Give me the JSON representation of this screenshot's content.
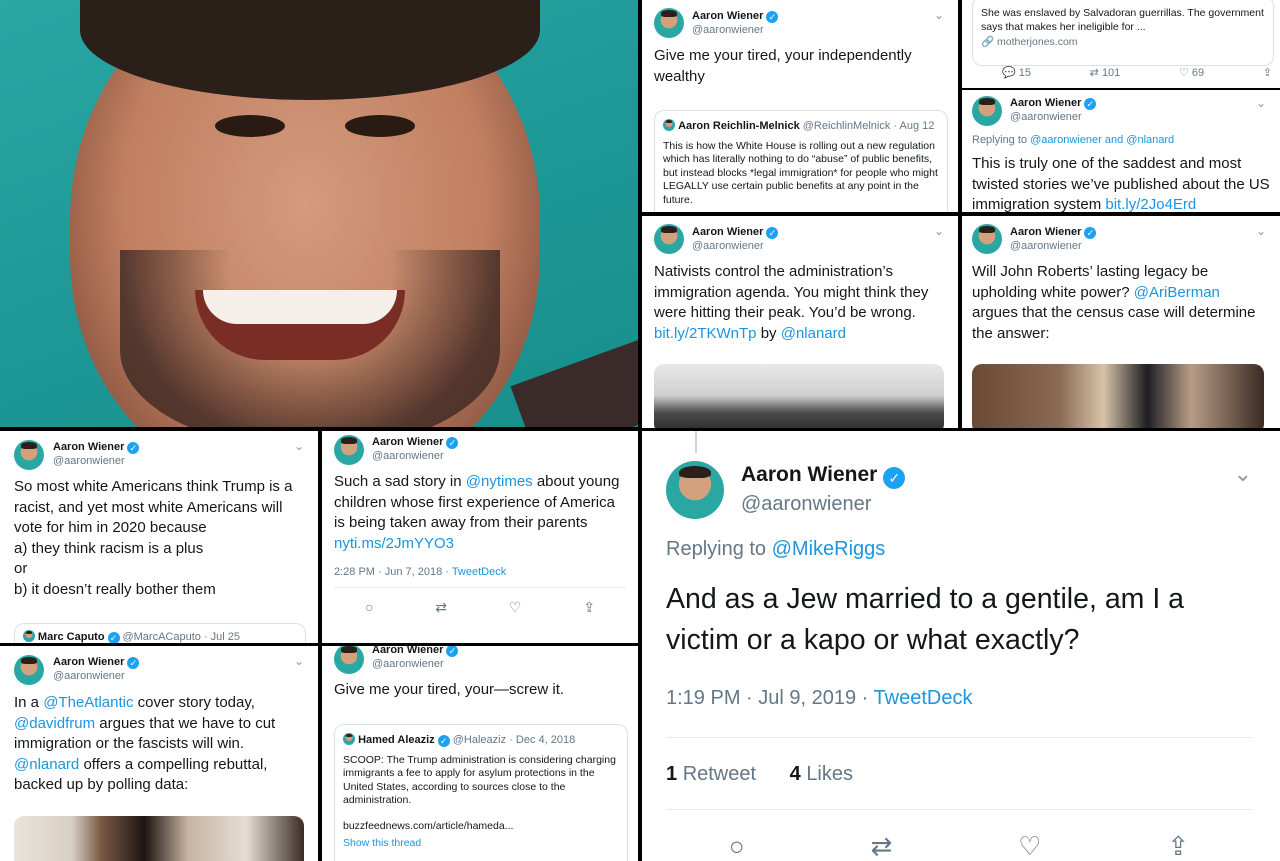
{
  "tweets": {
    "t1": {
      "name": "Aaron Wiener",
      "handle": "@aaronwiener",
      "text": "Give me your tired, your independently wealthy",
      "quote": {
        "name": "Aaron Reichlin-Melnick",
        "handle": "@ReichlinMelnick",
        "date": "· Aug 12",
        "text": "This is how the White House is rolling out a new regulation which has literally nothing to do “abuse” of public benefits, but instead blocks *legal immigration* for people who might LEGALLY use certain public benefits at any point in the future."
      }
    },
    "t2": {
      "card_text": "She was enslaved by Salvadoran guerrillas. The government says that makes her ineligible for ...",
      "card_domain": "motherjones.com",
      "replies": "15",
      "retweets": "101",
      "likes": "69"
    },
    "t3": {
      "name": "Aaron Wiener",
      "handle": "@aaronwiener",
      "replying_prefix": "Replying to",
      "replying_to": "@aaronwiener and @nlanard",
      "text": "This is truly one of the saddest and most twisted stories we’ve published about the US immigration system",
      "link": "bit.ly/2Jo4Erd"
    },
    "t4": {
      "name": "Aaron Wiener",
      "handle": "@aaronwiener",
      "text": "Nativists control the administration’s immigration agenda. You might think they were hitting their peak. You’d be wrong.",
      "link": "bit.ly/2TKWnTp",
      "by": "by",
      "mention": "@nlanard"
    },
    "t5": {
      "name": "Aaron Wiener",
      "handle": "@aaronwiener",
      "text_a": "Will John Roberts’ lasting legacy be upholding white power?",
      "mention": "@AriBerman",
      "text_b": "argues that the census case will determine the answer:"
    },
    "t6": {
      "name": "Aaron Wiener",
      "handle": "@aaronwiener",
      "text": "So most white Americans think Trump is a racist, and yet most white Americans will vote for him in 2020 because\na) they think racism is a plus\nor\nb) it doesn’t really bother them",
      "quote_name": "Marc Caputo",
      "quote_handle": "@MarcACaputo · Jul 25"
    },
    "t7": {
      "name": "Aaron Wiener",
      "handle": "@aaronwiener",
      "text_a": "Such a sad story in",
      "mention": "@nytimes",
      "text_b": "about young children whose first experience of America is being taken away from their parents",
      "link": "nyti.ms/2JmYYO3",
      "time": "2:28 PM · Jun 7, 2018 ·",
      "client": "TweetDeck"
    },
    "t8": {
      "name": "Aaron Wiener",
      "handle": "@aaronwiener",
      "reply_prefix": "Replying to",
      "reply_to": "@MikeRiggs",
      "text": "And as a Jew married to a gentile, am I a victim or a kapo or what exactly?",
      "time": "1:19 PM · Jul 9, 2019 ·",
      "client": "TweetDeck",
      "retweet_count": "1",
      "retweet_label": "Retweet",
      "like_count": "4",
      "like_label": "Likes"
    },
    "t9": {
      "name": "Aaron Wiener",
      "handle": "@aaronwiener",
      "text_a": "In a",
      "m1": "@TheAtlantic",
      "text_b": "cover story today,",
      "m2": "@davidfrum",
      "text_c": "argues that we have to cut immigration or the fascists will win.",
      "m3": "@nlanard",
      "text_d": "offers a compelling rebuttal, backed up by polling data:"
    },
    "t10": {
      "name": "Aaron Wiener",
      "handle": "@aaronwiener",
      "text": "Give me your tired, your—screw it.",
      "quote": {
        "name": "Hamed Aleaziz",
        "handle": "@Haleaziz · Dec 4, 2018",
        "text": "SCOOP: The Trump administration is considering charging immigrants a fee to apply for asylum protections in the United States, according to sources close to the administration.",
        "url": "buzzfeednews.com/article/hameda...",
        "thread": "Show this thread"
      }
    }
  }
}
